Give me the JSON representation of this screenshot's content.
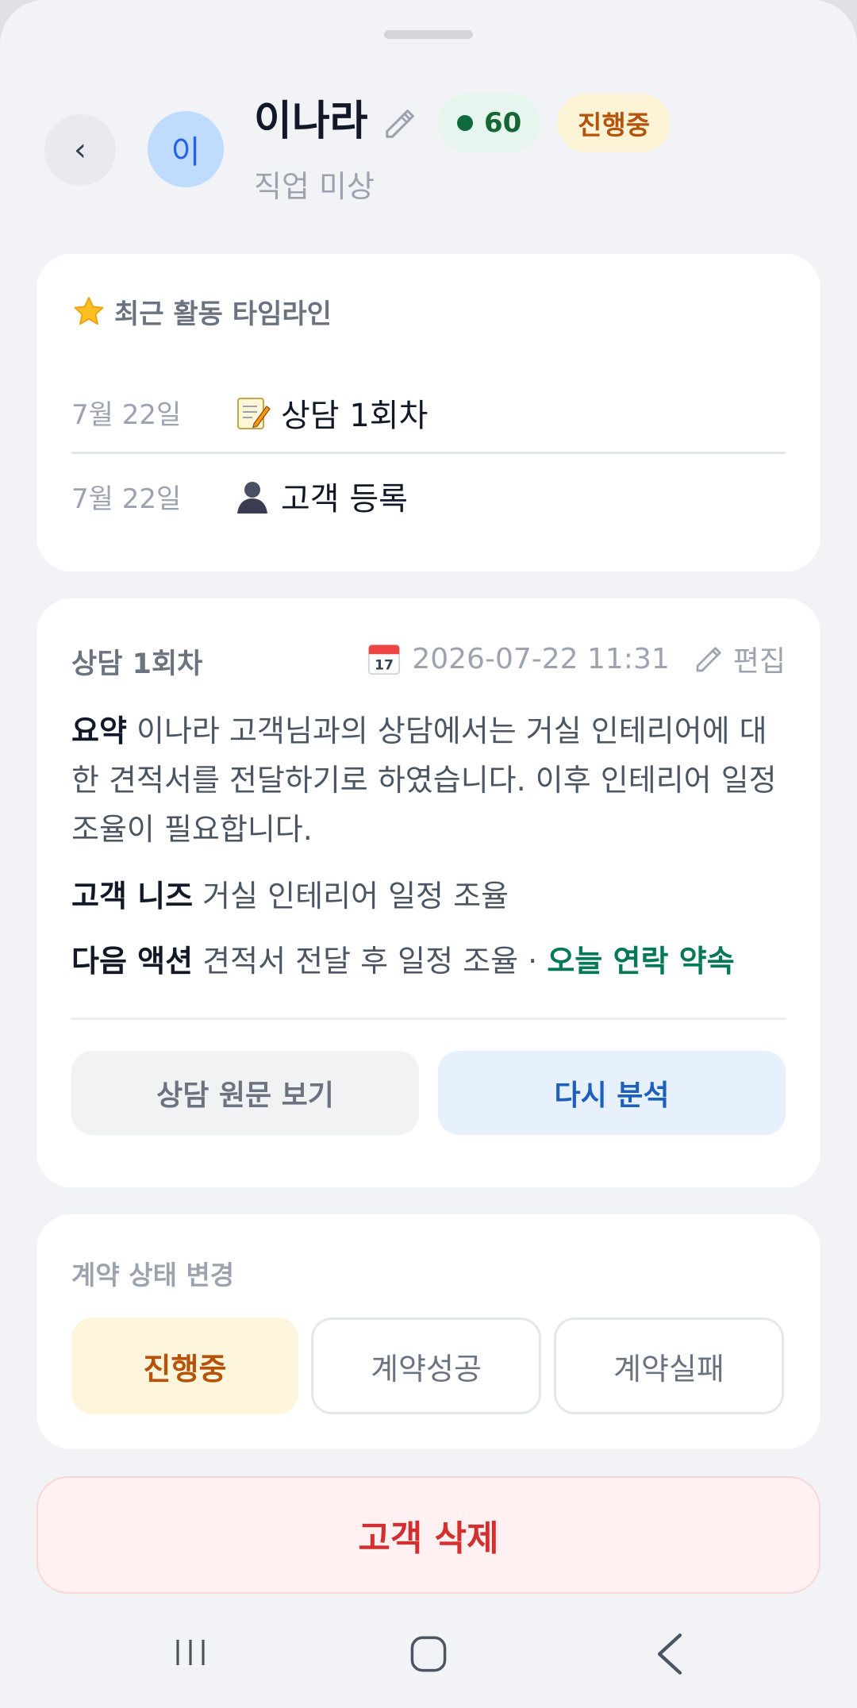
{
  "customer": {
    "avatar_initial": "이",
    "name": "이나라",
    "score": "60",
    "status": "진행중",
    "job": "직업 미상"
  },
  "timeline": {
    "title": "최근 활동 타임라인",
    "items": [
      {
        "date": "7월 22일",
        "icon": "memo-icon",
        "text": "상담 1회차"
      },
      {
        "date": "7월 22일",
        "icon": "person-icon",
        "text": "고객 등록"
      }
    ]
  },
  "consultation": {
    "title": "상담 1회차",
    "datetime": "2026-07-22 11:31",
    "edit_label": "편집",
    "summary_label": "요약",
    "summary_text": "이나라 고객님과의 상담에서는 거실 인테리어에 대한 견적서를 전달하기로 하였습니다. 이후 인테리어 일정 조율이 필요합니다.",
    "needs_label": "고객 니즈",
    "needs_text": "거실 인테리어 일정 조율",
    "next_label": "다음 액션",
    "next_text": "견적서 전달 후 일정 조율 · ",
    "next_promise": "오늘 연락 약속",
    "view_raw_label": "상담 원문 보기",
    "reanalyze_label": "다시 분석"
  },
  "contract": {
    "title": "계약 상태 변경",
    "options": [
      "진행중",
      "계약성공",
      "계약실패"
    ],
    "selected": "진행중"
  },
  "delete_label": "고객 삭제",
  "colors": {
    "accent_blue": "#1d5fbf",
    "score_green": "#0f6b3d",
    "status_amber": "#b45309",
    "danger_red": "#d32f2f"
  }
}
